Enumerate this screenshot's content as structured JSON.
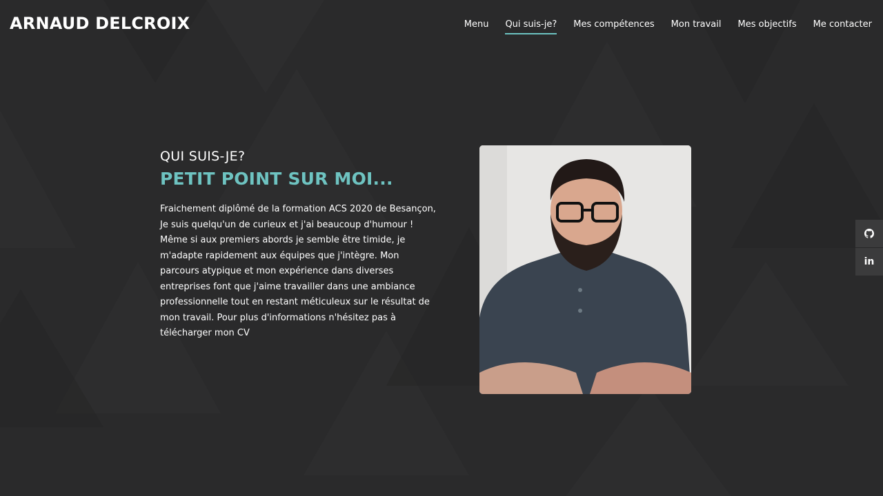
{
  "header": {
    "brand": "ARNAUD DELCROIX",
    "nav": [
      {
        "label": "Menu",
        "active": false
      },
      {
        "label": "Qui suis-je?",
        "active": true
      },
      {
        "label": "Mes compétences",
        "active": false
      },
      {
        "label": "Mon travail",
        "active": false
      },
      {
        "label": "Mes objectifs",
        "active": false
      },
      {
        "label": "Me contacter",
        "active": false
      }
    ]
  },
  "about": {
    "subtitle": "QUI SUIS-JE?",
    "title": "PETIT POINT SUR MOI...",
    "text": "Fraichement diplômé de la formation ACS 2020 de Besançon, Je suis quelqu'un de curieux et j'ai beaucoup d'humour ! Même si aux premiers abords je semble être timide, je m'adapte rapidement aux équipes que j'intègre. Mon parcours atypique et mon expérience dans diverses entreprises font que j'aime travailler dans une ambiance professionnelle tout en restant méticuleux sur le résultat de mon travail. Pour plus d'informations n'hésitez pas à télécharger mon CV"
  },
  "social": {
    "github_icon": "github-icon",
    "linkedin_icon": "linkedin-icon",
    "linkedin_glyph": "in"
  },
  "colors": {
    "accent": "#6ec3c1",
    "background": "#2a2a2b",
    "social_bg": "#3b3b3c"
  }
}
